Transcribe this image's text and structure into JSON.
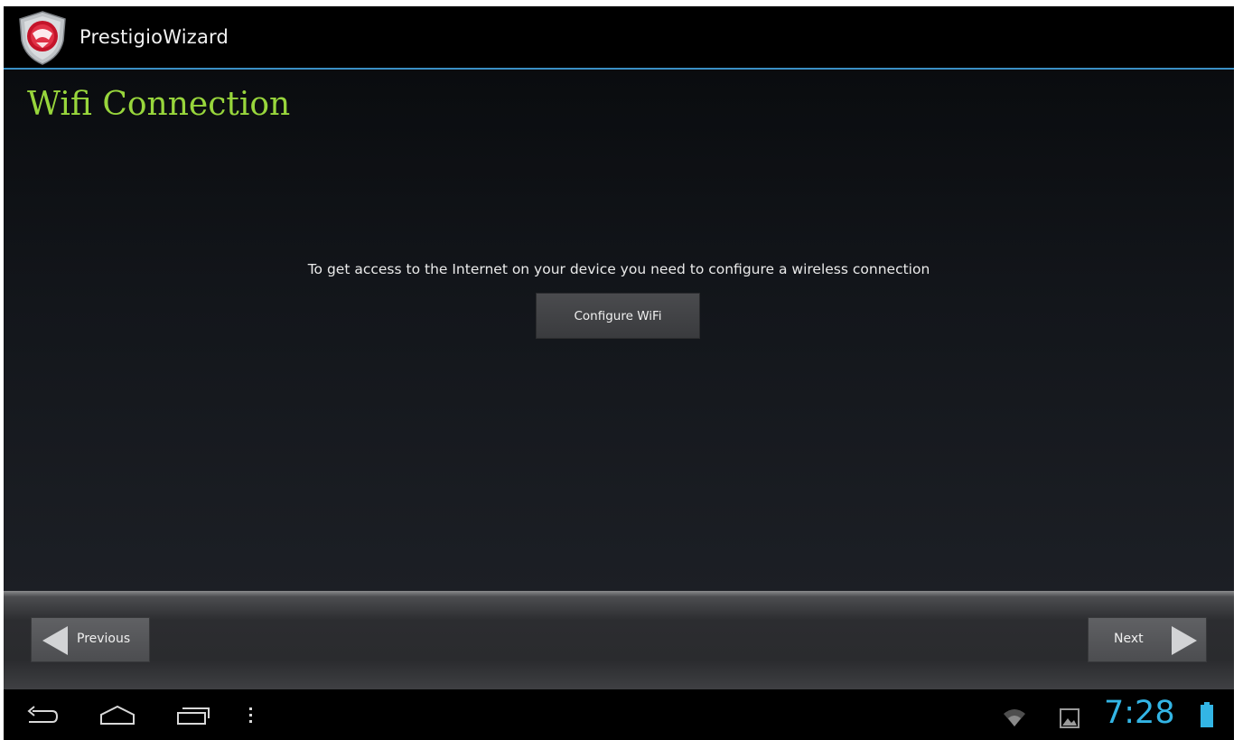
{
  "app": {
    "title": "PrestigioWizard",
    "logo_icon": "prestigio-shield-icon"
  },
  "page": {
    "title": "Wifi Connection",
    "message": "To get access to the Internet on your device you need to configure a wireless connection",
    "configure_button": "Configure WiFi"
  },
  "wizard_nav": {
    "previous_label": "Previous",
    "next_label": "Next"
  },
  "system_bar": {
    "time": "7:28",
    "icons": [
      "back-icon",
      "home-icon",
      "recent-apps-icon",
      "overflow-menu-icon",
      "wifi-icon",
      "gallery-icon",
      "battery-icon"
    ]
  },
  "colors": {
    "accent": "#33b5e5",
    "title_green": "#98d63c",
    "action_bar_line": "#3a8fc4"
  }
}
